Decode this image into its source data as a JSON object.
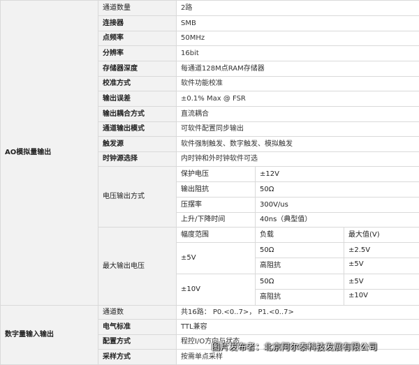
{
  "sections": {
    "ao": "AO模拟量输出",
    "di": "数字量输入输出"
  },
  "ao_rows": [
    {
      "label": "通道数量",
      "value": "2路"
    },
    {
      "label": "连接器",
      "value": "SMB"
    },
    {
      "label": "点频率",
      "value": "50MHz"
    },
    {
      "label": "分辨率",
      "value": "16bit"
    },
    {
      "label": "存储器深度",
      "value": "每通道128M点RAM存储器"
    },
    {
      "label": "校准方式",
      "value": "软件功能校准"
    },
    {
      "label": "输出误差",
      "value": "±0.1% Max @ FSR"
    },
    {
      "label": "输出耦合方式",
      "value": "直流耦合"
    },
    {
      "label": "通道输出模式",
      "value": "可软件配置同步输出"
    },
    {
      "label": "触发源",
      "value": "软件强制触发、数字触发、模拟触发"
    },
    {
      "label": "时钟源选择",
      "value": "内时钟和外时钟软件可选"
    }
  ],
  "voltage_output": {
    "label": "电压输出方式",
    "rows": [
      {
        "param": "保护电压",
        "value": "±12V"
      },
      {
        "param": "输出阻抗",
        "value": "50Ω"
      },
      {
        "param": "压摆率",
        "value": "300V/us"
      },
      {
        "param": "上升/下降时间",
        "value": "40ns（典型值）"
      }
    ]
  },
  "max_voltage": {
    "label": "最大输出电压",
    "headers": {
      "range": "幅度范围",
      "load": "负载",
      "max": "最大值(V)"
    },
    "groups": [
      {
        "range": "±5V",
        "rows": [
          {
            "load": "50Ω",
            "max": "±2.5V"
          },
          {
            "load": "高阻抗",
            "max": "±5V"
          }
        ]
      },
      {
        "range": "±10V",
        "rows": [
          {
            "load": "50Ω",
            "max": "±5V"
          },
          {
            "load": "高阻抗",
            "max": "±10V"
          }
        ]
      }
    ]
  },
  "di_rows": [
    {
      "label": "通道数",
      "value": "共16路： P0.<0..7>， P1.<0..7>"
    },
    {
      "label": "电气标准",
      "value": "TTL兼容"
    },
    {
      "label": "配置方式",
      "value": "程控I/O方向与状态"
    },
    {
      "label": "采样方式",
      "value": "按需单点采样"
    }
  ],
  "watermark": "图片发布者：北京阿尔泰科技发展有限公司"
}
